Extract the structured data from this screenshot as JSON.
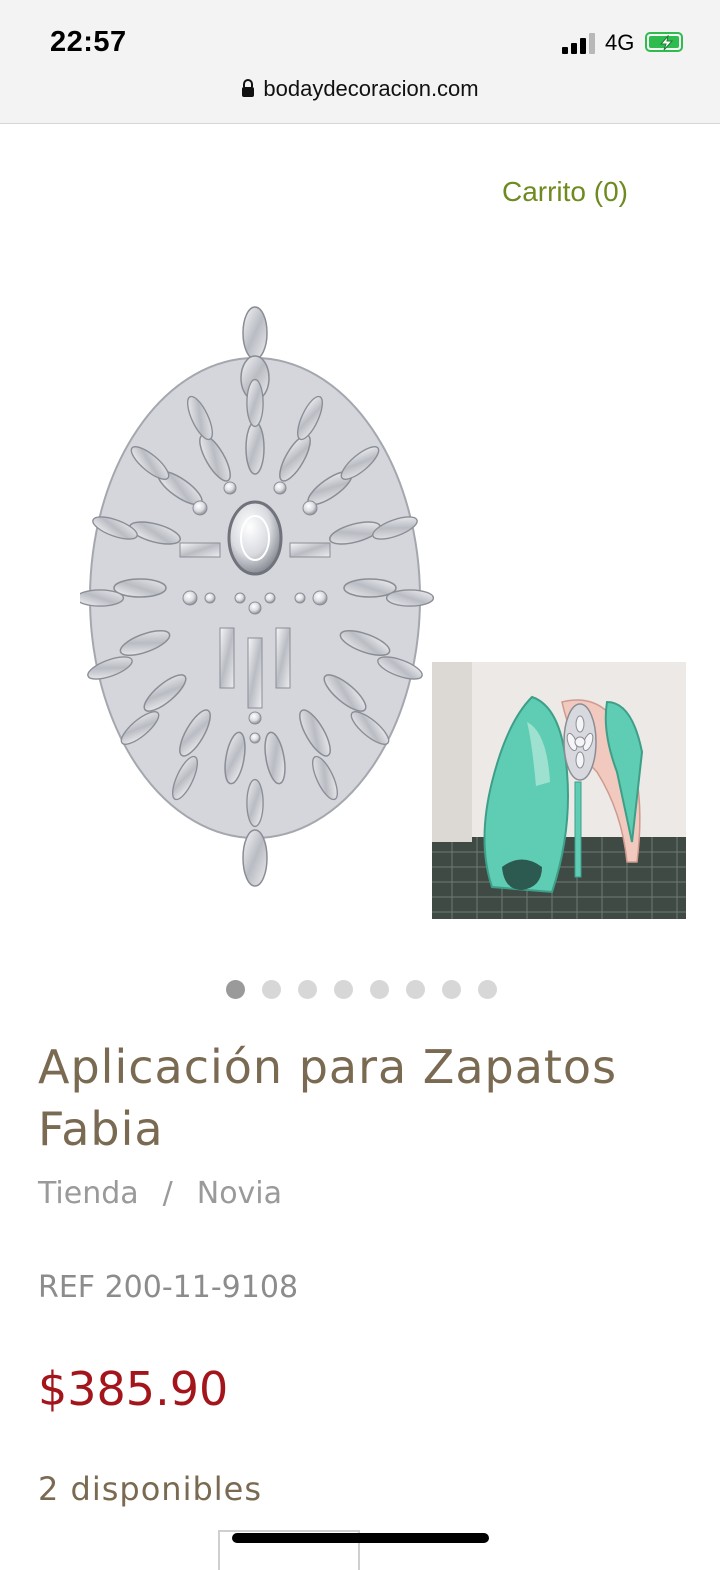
{
  "status_bar": {
    "time": "22:57",
    "network": "4G",
    "icons": [
      "signal-icon",
      "battery-charging-icon"
    ],
    "battery_color": "#2ebc4f"
  },
  "browser": {
    "url": "bodaydecoracion.com",
    "lock_icon": "lock-icon"
  },
  "header": {
    "cart_label": "Carrito (0)",
    "cart_color": "#6f8a1f"
  },
  "gallery": {
    "images": [
      "rhinestone-applique",
      "aqua-heels-with-applique"
    ],
    "slide_count": 8,
    "active_index": 0
  },
  "product": {
    "title": "Aplicación para Zapatos Fabia",
    "breadcrumb": [
      "Tienda",
      "Novia"
    ],
    "breadcrumb_separator": "/",
    "ref": "REF 200-11-9108",
    "price": "$385.90",
    "price_color": "#a3151b",
    "stock": "2 disponibles"
  }
}
